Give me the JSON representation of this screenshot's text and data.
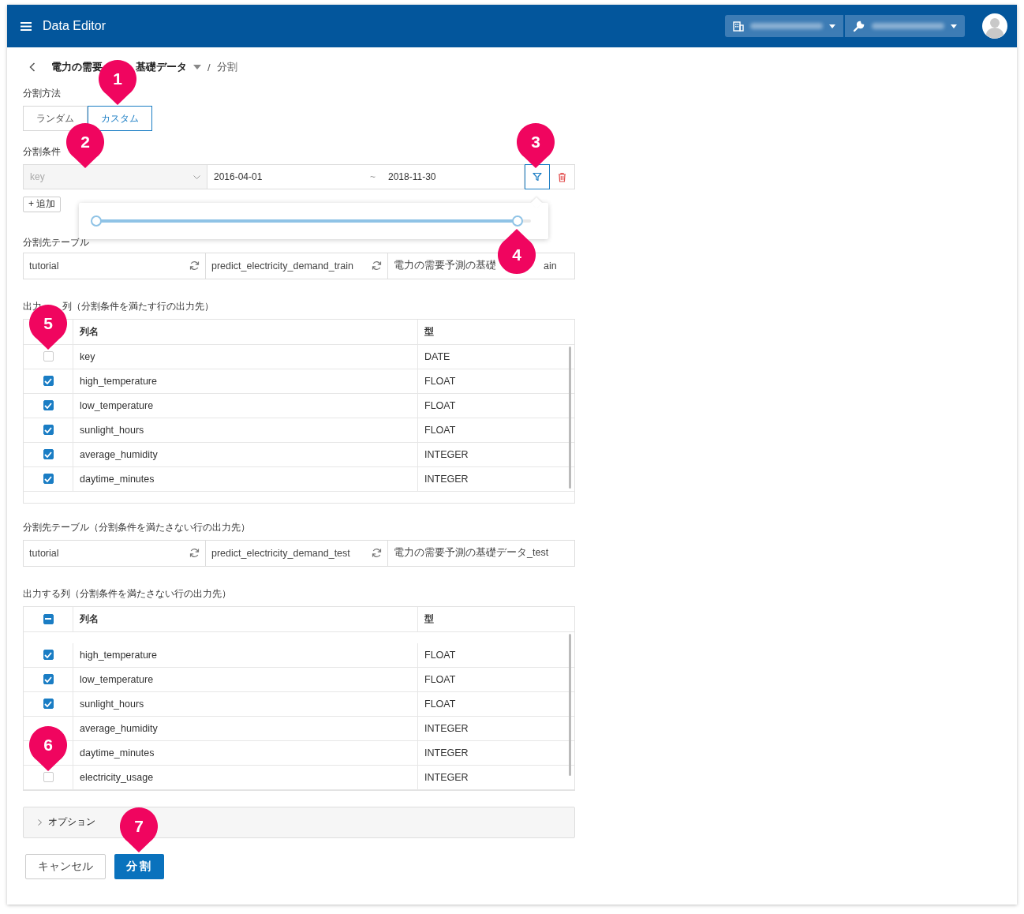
{
  "app": {
    "title": "Data Editor"
  },
  "breadcrumb": {
    "parent_parts": [
      "電力の需要",
      "基礎データ"
    ],
    "current": "分割",
    "separator": "/"
  },
  "split_method": {
    "label": "分割方法",
    "options": [
      {
        "label": "ランダム",
        "selected": false
      },
      {
        "label": "カスタム",
        "selected": true
      }
    ]
  },
  "split_condition": {
    "label": "分割条件",
    "column": {
      "placeholder": "key"
    },
    "from": "2016-04-01",
    "tilde": "~",
    "to": "2018-11-30",
    "filter_active": true,
    "add_button": "+ 追加",
    "slider": {
      "low": {
        "level": 0
      },
      "high": {
        "level": 0.97
      }
    }
  },
  "sections": [
    {
      "table_label": "分割先テーブル",
      "dataset": "tutorial",
      "table": "predict_electricity_demand_train",
      "description_parts": [
        "電力の需要予測の基礎",
        "ain"
      ],
      "columns_label_parts": [
        "出力",
        "列（分割条件を満たす行の出力先）"
      ],
      "header": {
        "name": "列名",
        "type": "型"
      },
      "rows": [
        {
          "name": "key",
          "type": "DATE",
          "checked": false
        },
        {
          "name": "high_temperature",
          "type": "FLOAT",
          "checked": true
        },
        {
          "name": "low_temperature",
          "type": "FLOAT",
          "checked": true
        },
        {
          "name": "sunlight_hours",
          "type": "FLOAT",
          "checked": true
        },
        {
          "name": "average_humidity",
          "type": "INTEGER",
          "checked": true
        },
        {
          "name": "daytime_minutes",
          "type": "INTEGER",
          "checked": true
        }
      ]
    },
    {
      "table_label": "分割先テーブル（分割条件を満たさない行の出力先）",
      "dataset": "tutorial",
      "table": "predict_electricity_demand_test",
      "description_parts": [
        "電力の需要予測の基礎データ_test"
      ],
      "columns_label_parts": [
        "出力する列（分割条件を満たさない行の出力先）"
      ],
      "header": {
        "name": "列名",
        "type": "型",
        "indeterminate": true
      },
      "rows": [
        {
          "name": "high_temperature",
          "type": "FLOAT",
          "checked": true
        },
        {
          "name": "low_temperature",
          "type": "FLOAT",
          "checked": true
        },
        {
          "name": "sunlight_hours",
          "type": "FLOAT",
          "checked": true
        },
        {
          "name": "average_humidity",
          "type": "INTEGER"
        },
        {
          "name": "daytime_minutes",
          "type": "INTEGER"
        },
        {
          "name": "electricity_usage",
          "type": "INTEGER",
          "checked": false
        }
      ]
    }
  ],
  "options": {
    "label": "オプション",
    "expanded": false
  },
  "buttons": {
    "cancel": "キャンセル",
    "submit": "分割"
  },
  "callouts": [
    {
      "number": "1",
      "points_up": false
    },
    {
      "number": "2",
      "points_up": false
    },
    {
      "number": "3",
      "points_up": false
    },
    {
      "number": "4",
      "points_up": true
    },
    {
      "number": "5",
      "points_up": false
    },
    {
      "number": "6",
      "points_up": false
    },
    {
      "number": "7",
      "points_up": false
    }
  ]
}
